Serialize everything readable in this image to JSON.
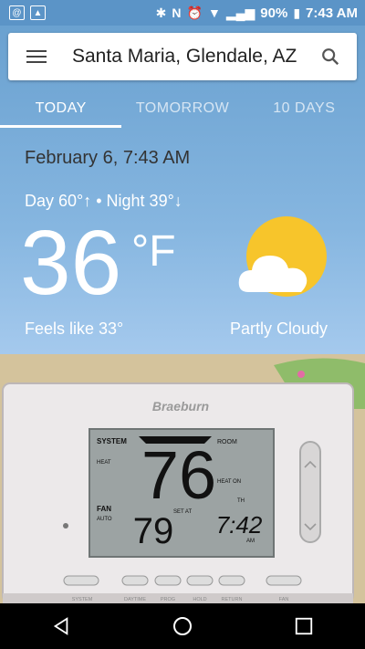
{
  "status": {
    "battery": "90%",
    "time": "7:43 AM"
  },
  "search": {
    "location": "Santa Maria, Glendale, AZ"
  },
  "tabs": [
    {
      "label": "TODAY"
    },
    {
      "label": "TOMORROW"
    },
    {
      "label": "10 DAYS"
    }
  ],
  "weather": {
    "datetime": "February 6, 7:43 AM",
    "day_night": "Day 60°↑ • Night 39°↓",
    "temp": "36",
    "unit": "°F",
    "feels_like": "Feels like 33°",
    "condition": "Partly Cloudy"
  },
  "thermostat": {
    "brand": "Braeburn",
    "system": "SYSTEM",
    "heat": "HEAT",
    "fan": "FAN",
    "auto": "AUTO",
    "room": "ROOM",
    "heat_on": "HEAT ON",
    "th": "TH",
    "set_at": "SET AT",
    "room_temp": "76",
    "set_temp": "79",
    "clock": "7:42",
    "am": "AM",
    "buttons": [
      "SYSTEM",
      "DAYTIME",
      "PROG",
      "HOLD",
      "RETURN",
      "FAN"
    ]
  },
  "colors": {
    "sky": "#6aa1d0",
    "sun": "#f7c52b",
    "statusbar": "#5b94c7"
  }
}
